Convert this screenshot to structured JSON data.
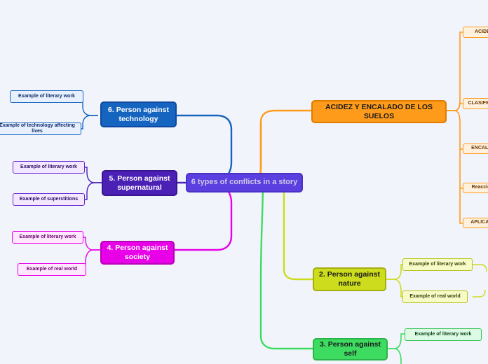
{
  "diagram": {
    "type": "mindmap",
    "title": "6 types of conflicts in a story",
    "center": {
      "label": "6 types of conflicts in a story"
    },
    "colors": {
      "background": "#f2f4fb",
      "center": "#5b3fe0",
      "technology": "#1565c0",
      "supernatural": "#4b20b5",
      "society": "#e800e8",
      "nature": "#cddc1c",
      "self": "#3ddc61",
      "acidez": "#ff9b1a"
    },
    "branches": [
      {
        "id": "technology",
        "label": "6. Person against technology",
        "children": [
          {
            "label": "Example of literary work"
          },
          {
            "label": "Example of technology affecting lives"
          }
        ]
      },
      {
        "id": "supernatural",
        "label": "5. Person against supernatural",
        "children": [
          {
            "label": "Example of literary work"
          },
          {
            "label": "Example of superstitions"
          }
        ]
      },
      {
        "id": "society",
        "label": "4. Person against society",
        "children": [
          {
            "label": "Example of literary work"
          },
          {
            "label": "Example of real world"
          }
        ]
      },
      {
        "id": "nature",
        "label": "2. Person against nature",
        "children": [
          {
            "label": "Example of literary work"
          },
          {
            "label": "Example of real world"
          }
        ]
      },
      {
        "id": "self",
        "label": "3. Person against self",
        "children": [
          {
            "label": "Example of literary work"
          }
        ]
      },
      {
        "id": "acidez",
        "label": "ACIDEZ Y ENCALADO DE LOS SUELOS",
        "children": [
          {
            "label": "ACIDEZ"
          },
          {
            "label": "CLASIFICACION"
          },
          {
            "label": "ENCALADO"
          },
          {
            "label": "Reacciones"
          },
          {
            "label": "APLICACION"
          }
        ]
      }
    ]
  }
}
